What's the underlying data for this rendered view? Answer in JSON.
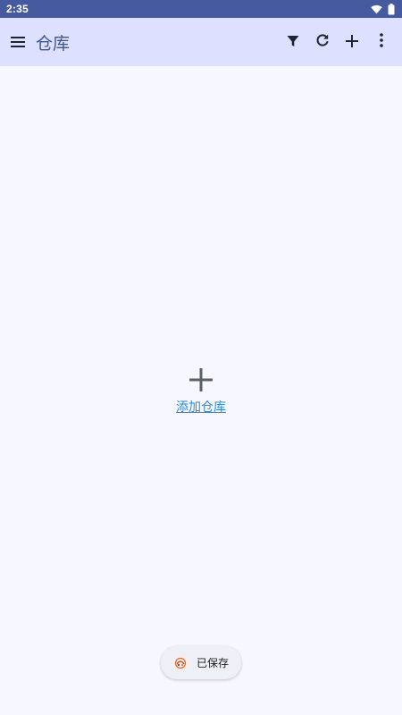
{
  "status_bar": {
    "time": "2:35",
    "icons": [
      "wifi-icon",
      "battery-icon"
    ],
    "background": "#465aa0"
  },
  "app_bar": {
    "title": "仓库",
    "menu_icon": "menu-icon",
    "actions": [
      "filter-icon",
      "refresh-icon",
      "add-icon",
      "more-vert-icon"
    ],
    "background": "#dde1ff",
    "title_color": "#3f5596"
  },
  "empty_state": {
    "icon": "add-icon",
    "link_text": "添加仓库",
    "link_color": "#2a8cdc"
  },
  "toast": {
    "icon": "app-logo-icon",
    "text": "已保存"
  }
}
